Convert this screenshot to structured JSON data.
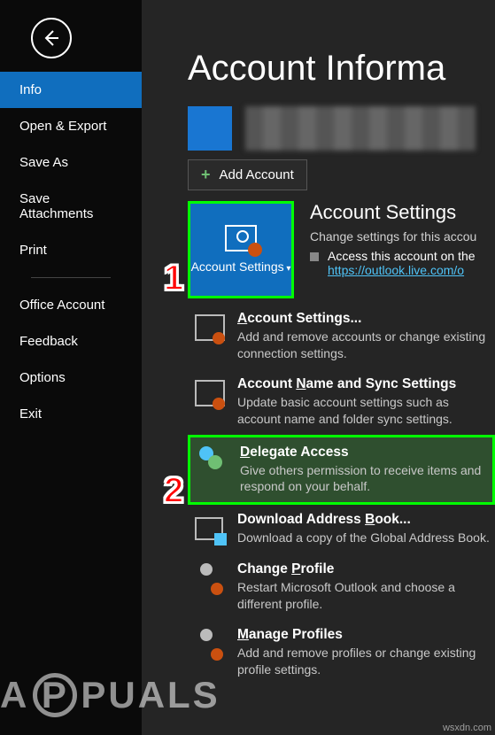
{
  "page_title": "Account Informa",
  "sidebar": {
    "items": [
      {
        "label": "Info",
        "active": true
      },
      {
        "label": "Open & Export"
      },
      {
        "label": "Save As"
      },
      {
        "label": "Save Attachments"
      },
      {
        "label": "Print"
      }
    ],
    "items2": [
      {
        "label": "Office Account"
      },
      {
        "label": "Feedback"
      },
      {
        "label": "Options"
      },
      {
        "label": "Exit"
      }
    ]
  },
  "add_account_label": "Add Account",
  "account_settings_button": "Account Settings",
  "section": {
    "heading": "Account Settings",
    "desc": "Change settings for this accou",
    "bullet_text": "Access this account on the",
    "link": "https://outlook.live.com/o"
  },
  "menu": [
    {
      "title_pre": "A",
      "title_rest": "ccount Settings...",
      "desc": "Add and remove accounts or change existing connection settings."
    },
    {
      "title_pre": "Account ",
      "title_u": "N",
      "title_rest": "ame and Sync Settings",
      "desc": "Update basic account settings such as account name and folder sync settings."
    },
    {
      "title_pre": "",
      "title_u": "D",
      "title_rest": "elegate Access",
      "desc": "Give others permission to receive items and respond on your behalf."
    },
    {
      "title_pre": "Download Address ",
      "title_u": "B",
      "title_rest": "ook...",
      "desc": "Download a copy of the Global Address Book."
    },
    {
      "title_pre": "Change ",
      "title_u": "P",
      "title_rest": "rofile",
      "desc": "Restart Microsoft Outlook and choose a different profile."
    },
    {
      "title_pre": "",
      "title_u": "M",
      "title_rest": "anage Profiles",
      "desc": "Add and remove profiles or change existing profile settings."
    }
  ],
  "callouts": {
    "1": "1",
    "2": "2"
  },
  "watermark": {
    "pre": "A",
    "mid": "P",
    "post": "PUALS"
  },
  "corner": "wsxdn.com"
}
